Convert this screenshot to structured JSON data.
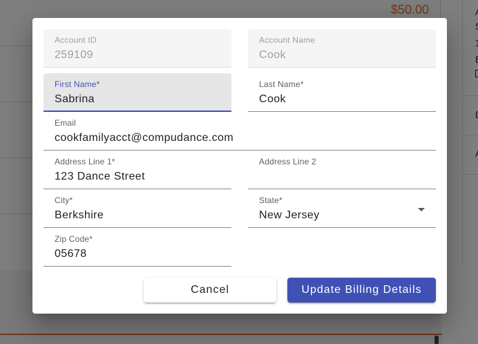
{
  "background": {
    "amount": "$50.00",
    "right_column_letters": [
      "A",
      "S",
      "1",
      "E",
      "D",
      "A"
    ]
  },
  "dialog": {
    "fields": {
      "account_id": {
        "label": "Account ID",
        "value": "259109"
      },
      "account_name": {
        "label": "Account Name",
        "value": "Cook"
      },
      "first_name": {
        "label": "First Name*",
        "value": "Sabrina"
      },
      "last_name": {
        "label": "Last Name*",
        "value": "Cook"
      },
      "email": {
        "label": "Email",
        "value": "cookfamilyacct@compudance.com"
      },
      "address_line_1": {
        "label": "Address Line 1*",
        "value": "123 Dance Street"
      },
      "address_line_2": {
        "label": "Address Line 2",
        "value": ""
      },
      "city": {
        "label": "City*",
        "value": "Berkshire"
      },
      "state": {
        "label": "State*",
        "value": "New Jersey"
      },
      "zip_code": {
        "label": "Zip Code*",
        "value": "05678"
      }
    },
    "buttons": {
      "cancel": "Cancel",
      "update": "Update Billing Details"
    }
  },
  "icons": {
    "state_dropdown": "caret-down-icon",
    "checkbox_icon": "checkbox-icon"
  },
  "colors": {
    "primary": "#3f51b5",
    "amount": "#e0703a"
  }
}
